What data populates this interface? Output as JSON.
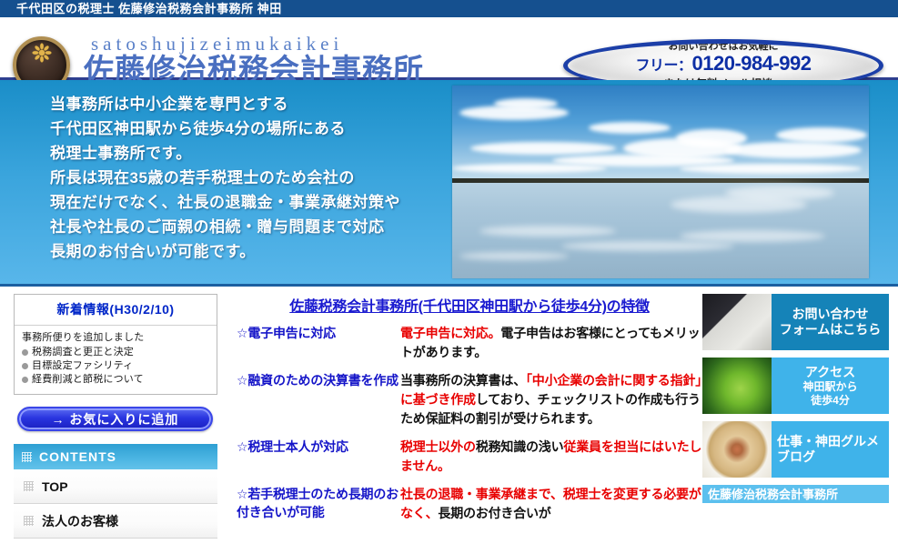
{
  "topbar": {
    "text": "千代田区の税理士 佐藤修治税務会計事務所 神田"
  },
  "header": {
    "logo_name": "office-seal-logo",
    "romaji": "satoshujizeimukaikei",
    "kanji": "佐藤修治税務会計事務所",
    "tel": {
      "top": "お問い合わせはお気軽に",
      "prefix": "フリー：",
      "number": "0120-984-992",
      "bottom": "または無料メール相談へ"
    }
  },
  "hero": {
    "lines": [
      "当事務所は中小企業を専門とする",
      "千代田区神田駅から徒歩4分の場所にある",
      "税理士事務所です。",
      "所長は現在35歳の若手税理士のため会社の",
      "現在だけでなく、社長の退職金・事業承継対策や",
      "社長や社長のご両親の相続・贈与問題まで対応",
      "長期のお付合いが可能です。"
    ],
    "photo_alt": "lake-sky-reflection-photo"
  },
  "sidebar": {
    "news": {
      "title": "新着情報(H30/2/10)",
      "lead": "事務所便りを追加しました",
      "items": [
        "税務調査と更正と決定",
        "目標設定ファシリティ",
        "経費削減と節税について"
      ]
    },
    "favorite_button": "→ お気に入りに追加",
    "contents_title": "CONTENTS",
    "menu": [
      {
        "label": "TOP"
      },
      {
        "label": "法人のお客様"
      }
    ]
  },
  "main": {
    "title": "佐藤税務会計事務所(千代田区神田駅から徒歩4分)の特徴",
    "features": [
      {
        "label": "☆電子申告に対応",
        "desc_segments": [
          {
            "text": "電子申告に対応。",
            "color": "red"
          },
          {
            "text": "電子申告はお客様にとってもメリットがあります。",
            "color": "black"
          }
        ]
      },
      {
        "label": "☆融資のための決算書を作成",
        "desc_segments": [
          {
            "text": "当事務所の決算書は、",
            "color": "black"
          },
          {
            "text": "「中小企業の会計に関する指針」に基づき作成",
            "color": "red"
          },
          {
            "text": "しており、チェックリストの作成も行うため保証料の割引が受けられます。",
            "color": "black"
          }
        ]
      },
      {
        "label": "☆税理士本人が対応",
        "desc_segments": [
          {
            "text": "税理士以外の",
            "color": "red"
          },
          {
            "text": "税務知識の浅い",
            "color": "black"
          },
          {
            "text": "従業員を担当にはいたしません。",
            "color": "red"
          }
        ]
      },
      {
        "label": "☆若手税理士のため長期のお付き合いが可能",
        "desc_segments": [
          {
            "text": "社長の退職・事業承継まで、税理士を変更する必要がなく、",
            "color": "red"
          },
          {
            "text": "長期のお付き合いが",
            "color": "black"
          }
        ]
      }
    ]
  },
  "right_banners": [
    {
      "name": "contact-form-banner",
      "line1": "お問い合わせ",
      "line2": "フォームはこちら",
      "image": "keyboard-phone-photo"
    },
    {
      "name": "access-banner",
      "line1": "アクセス",
      "line2": "神田駅から",
      "line3": "徒歩4分",
      "image": "ginkgo-leaf-photo"
    },
    {
      "name": "blog-banner",
      "line1": "仕事・神田グルメ",
      "line2": "ブログ",
      "image": "food-plate-photo"
    }
  ],
  "bottom_banner": {
    "text": "佐藤修治税務会計事務所"
  },
  "colors": {
    "topbar": "#15508f",
    "brand_blue": "#4a6fc0",
    "hero_top": "#1a8ec8",
    "hero_bottom": "#58b6ea",
    "accent_cyan": "#3fb3ea",
    "contents_header": "#4ab4e2",
    "link_blue": "#1a1ad0",
    "highlight_red": "#e80000",
    "news_title": "#0026c8",
    "fav_button": "#2a35e0"
  }
}
